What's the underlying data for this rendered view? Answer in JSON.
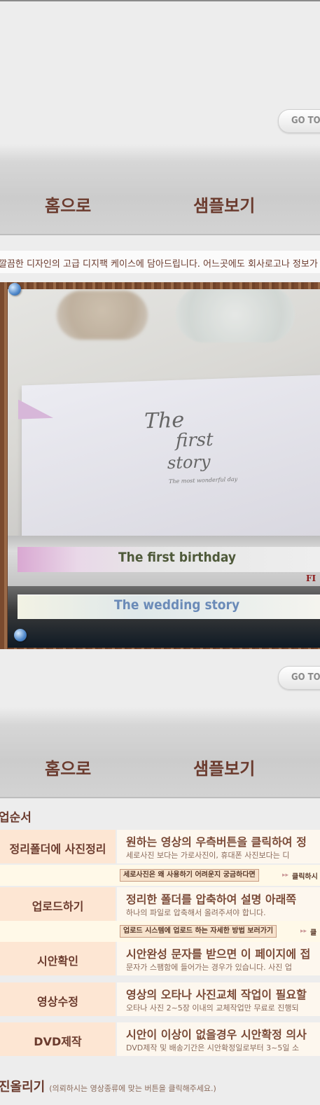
{
  "goto_button": {
    "label": "GO TO T"
  },
  "nav": {
    "home": "홈으로",
    "samples": "샘플보기"
  },
  "intro_text": "깔끔한 디자인의 고급 디지팩 케이스에 담아드립니다. 어느곳에도 회사로고나 정보가 들",
  "photo": {
    "book_title_1": "The",
    "book_title_2": "first",
    "book_title_3": "story",
    "book_subtitle": "The most wonderful day",
    "dvd_label_1": "The first birthday",
    "dvd_label_2": "The wedding story",
    "corner_mark": "FI"
  },
  "order": {
    "title": "업순서",
    "rows": [
      {
        "label": "정리폴더에 사진정리",
        "main": "원하는 영상의 우측버튼을 클릭하여 정",
        "sub": "세로사진 보다는 가로사진이, 휴대폰 사진보다는 디"
      },
      {
        "label": "업로드하기",
        "main": "정리한 폴더를 압축하여 설명 아래쪽",
        "sub": "하나의 파일로 압축해서 올려주셔야 합니다."
      },
      {
        "label": "시안확인",
        "main": "시안완성 문자를 받으면 이 페이지에 접",
        "sub": "문자가 스팸함에 들어가는 경우가 있습니다. 사진 업"
      },
      {
        "label": "영상수정",
        "main": "영상의 오타나 사진교체 작업이 필요할",
        "sub": "오타나 사진 2~5장 이내의 교체작업만 무료로 진행되"
      },
      {
        "label": "DVD제작",
        "main": "시안이 이상이 없을경우 시안확정 의사",
        "sub": "DVD제작 및 배송기간은 시안확정일로부터 3~5일 소"
      }
    ],
    "help1": {
      "button": "세로사진은 왜 사용하기 어려운지 궁금하다면",
      "more": "클릭하시"
    },
    "help2": {
      "button": "업로드 시스템에 업로드 하는 자세한 방법 보러가기",
      "more": "클"
    }
  },
  "bottom": {
    "title": "진올리기",
    "hint": "(의뢰하시는 영상종류에 맞는 버튼을 클릭해주세요.)"
  }
}
